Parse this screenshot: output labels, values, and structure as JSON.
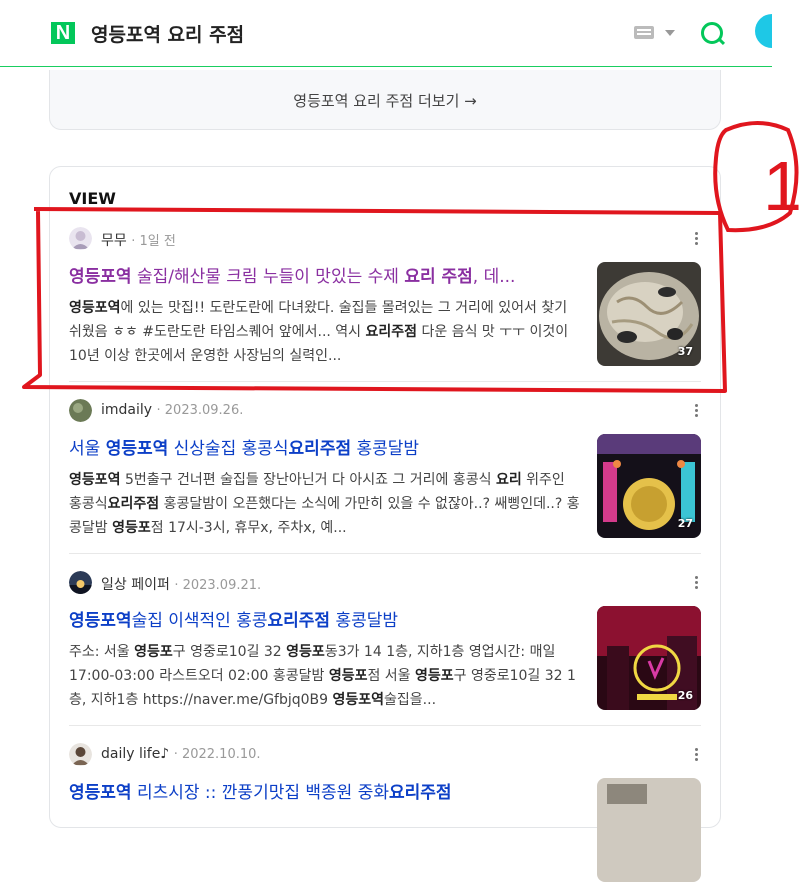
{
  "header": {
    "logo": "N",
    "query": "영등포역 요리 주점"
  },
  "more_link": "영등포역 요리 주점 더보기 →",
  "view_section": {
    "title": "VIEW",
    "posts": [
      {
        "author": "무무",
        "date": "1일 전",
        "title_parts": [
          {
            "t": "영등포역",
            "b": true
          },
          {
            "t": " 술집/해산물 크림 누들이 맛있는 수제 ",
            "b": false
          },
          {
            "t": "요리 주점",
            "b": true
          },
          {
            "t": ", 데...",
            "b": false
          }
        ],
        "desc_parts": [
          {
            "t": "영등포역",
            "b": true
          },
          {
            "t": "에 있는 맛집!! 도란도란에 다녀왔다. 술집들 몰려있는 그 거리에 있어서 찾기 쉬웠음 ㅎㅎ #도란도란 타임스퀘어 앞에서... 역시 ",
            "b": false
          },
          {
            "t": "요리주점",
            "b": true
          },
          {
            "t": " 다운 음식 맛 ㅜㅜ 이것이 10년 이상 한곳에서 운영한 사장님의 실력인...",
            "b": false
          }
        ],
        "image_count": "37",
        "visited": true
      },
      {
        "author": "imdaily",
        "date": "2023.09.26.",
        "title_parts": [
          {
            "t": "서울 ",
            "b": false
          },
          {
            "t": "영등포역",
            "b": true
          },
          {
            "t": " 신상술집 홍콩식",
            "b": false
          },
          {
            "t": "요리주점",
            "b": true
          },
          {
            "t": " 홍콩달밤",
            "b": false
          }
        ],
        "desc_parts": [
          {
            "t": "영등포역",
            "b": true
          },
          {
            "t": " 5번출구 건너편 술집들 장난아닌거 다 아시죠 그 거리에 홍콩식 ",
            "b": false
          },
          {
            "t": "요리",
            "b": true
          },
          {
            "t": " 위주인 홍콩식",
            "b": false
          },
          {
            "t": "요리주점",
            "b": true
          },
          {
            "t": " 홍콩달밤이 오픈했다는 소식에 가만히 있을 수 없잖아..? 쌔삥인데..? 홍콩달밤 ",
            "b": false
          },
          {
            "t": "영등포",
            "b": true
          },
          {
            "t": "점 17시-3시, 휴무x, 주차x, 예...",
            "b": false
          }
        ],
        "image_count": "27",
        "visited": false
      },
      {
        "author": "일상 페이퍼",
        "date": "2023.09.21.",
        "title_parts": [
          {
            "t": "영등포역",
            "b": true
          },
          {
            "t": "술집 이색적인 홍콩",
            "b": false
          },
          {
            "t": "요리주점",
            "b": true
          },
          {
            "t": " 홍콩달밤",
            "b": false
          }
        ],
        "desc_parts": [
          {
            "t": "주소: 서울 ",
            "b": false
          },
          {
            "t": "영등포",
            "b": true
          },
          {
            "t": "구 영중로10길 32 ",
            "b": false
          },
          {
            "t": "영등포",
            "b": true
          },
          {
            "t": "동3가 14 1층, 지하1층 영업시간: 매일 17:00-03:00 라스트오더 02:00 홍콩달밤 ",
            "b": false
          },
          {
            "t": "영등포",
            "b": true
          },
          {
            "t": "점 서울 ",
            "b": false
          },
          {
            "t": "영등포",
            "b": true
          },
          {
            "t": "구 영중로10길 32 1층, 지하1층 https://naver.me/Gfbjq0B9 ",
            "b": false
          },
          {
            "t": "영등포역",
            "b": true
          },
          {
            "t": "술집을...",
            "b": false
          }
        ],
        "image_count": "26",
        "visited": false
      },
      {
        "author": "daily life♪",
        "date": "2022.10.10.",
        "title_parts": [
          {
            "t": "영등포역",
            "b": true
          },
          {
            "t": " 리츠시장 :: 깐풍기맛집 백종원 중화",
            "b": false
          },
          {
            "t": "요리주점",
            "b": true
          }
        ],
        "desc_parts": [],
        "image_count": "",
        "visited": false
      }
    ]
  },
  "colors": {
    "naver_green": "#03c75a",
    "link_blue": "#0c3fc7",
    "visited_purple": "#8a2fa1",
    "annotation_red": "#e0161e"
  },
  "annotation": {
    "label": "1"
  }
}
